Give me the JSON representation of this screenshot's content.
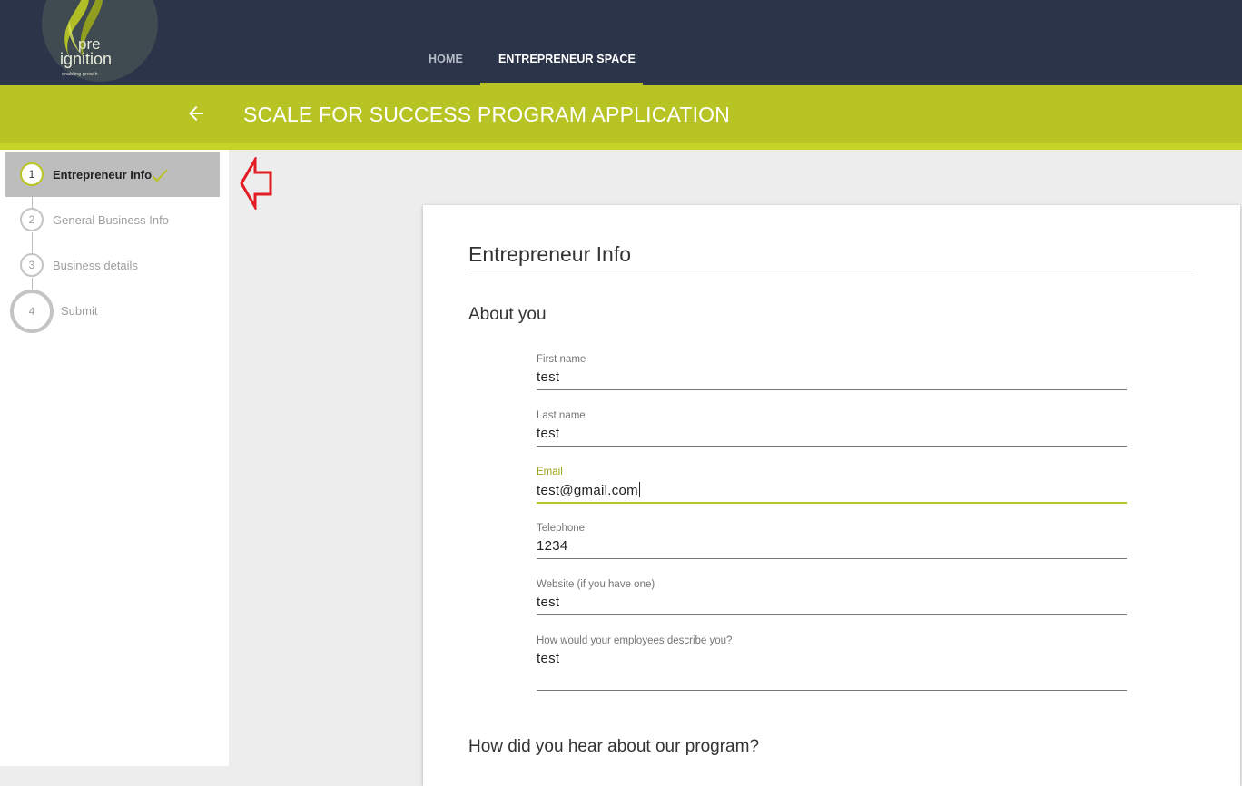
{
  "brand": {
    "logo_line1": "pre",
    "logo_line2": "ignition",
    "logo_tagline": "enabling    growth"
  },
  "nav": {
    "items": [
      {
        "label": "HOME"
      },
      {
        "label": "ENTREPRENEUR SPACE",
        "active": true
      }
    ]
  },
  "header": {
    "title": "SCALE FOR SUCCESS PROGRAM APPLICATION",
    "back_icon": "arrow-left-icon"
  },
  "stepper": {
    "steps": [
      {
        "number": "1",
        "label": "Entrepreneur Info",
        "active": true,
        "completed": true
      },
      {
        "number": "2",
        "label": "General Business Info"
      },
      {
        "number": "3",
        "label": "Business details"
      },
      {
        "number": "4",
        "label": "Submit"
      }
    ]
  },
  "form": {
    "title": "Entrepreneur Info",
    "section_about": "About you",
    "section_hear": "How did you hear about our program?",
    "fields": {
      "first_name": {
        "label": "First name",
        "value": "test"
      },
      "last_name": {
        "label": "Last name",
        "value": "test"
      },
      "email": {
        "label": "Email",
        "value": "test@gmail.com",
        "focused": true
      },
      "telephone": {
        "label": "Telephone",
        "value": "1234"
      },
      "website": {
        "label": "Website (if you have one)",
        "value": "test"
      },
      "employees": {
        "label": "How would your employees describe you?",
        "value": "test"
      }
    }
  },
  "colors": {
    "nav_bg": "#2c3449",
    "accent": "#b8c423",
    "annotation_arrow": "#e31b23"
  }
}
